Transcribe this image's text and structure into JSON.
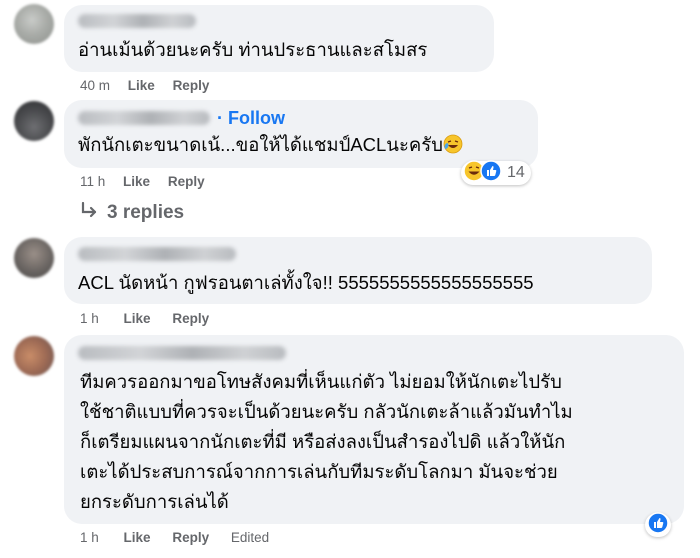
{
  "comments": [
    {
      "text_lines": [
        "อ่านเม้นด้วยนะครับ ท่านประธานและสโมสร"
      ],
      "time": "40 m",
      "like_label": "Like",
      "reply_label": "Reply"
    },
    {
      "follow_label": "Follow",
      "follow_separator": "·",
      "text_lines": [
        "พักนักเตะขนาดเน้...ขอให้ได้แชมป์ACLนะครับ"
      ],
      "time": "11 h",
      "like_label": "Like",
      "reply_label": "Reply",
      "reactions": {
        "count": "14",
        "icons": [
          "haha-icon",
          "like-icon"
        ]
      },
      "replies_label": "3 replies"
    },
    {
      "text_lines": [
        "ACL นัดหน้า กูฟรอนตาเล่ทั้งใจ!! 5555555555555555555"
      ],
      "time": "1 h",
      "like_label": "Like",
      "reply_label": "Reply"
    },
    {
      "text_lines": [
        "ทีมควรออกมาขอโทษสังคมที่เห็นแก่ตัว ไม่ยอมให้นักเตะไปรับ",
        "ใช้ชาติแบบที่ควรจะเป็นด้วยนะครับ กลัวนักเตะล้าแล้วมันทำไม",
        "ก็เตรียมแผนจากนักเตะที่มี หรือส่งลงเป็นสำรองไปดิ แล้วให้นัก",
        "เตะได้ประสบการณ์จากการเล่นกับทีมระดับโลกมา มันจะช่วย",
        "ยกระดับการเล่นได้"
      ],
      "time": "1 h",
      "like_label": "Like",
      "reply_label": "Reply",
      "edited_label": "Edited",
      "reactions": {
        "icons": [
          "like-icon"
        ]
      }
    }
  ],
  "colors": {
    "bubble": "#f0f2f5",
    "meta_text": "#65676b",
    "link_blue": "#1877f2",
    "text": "#050505"
  }
}
